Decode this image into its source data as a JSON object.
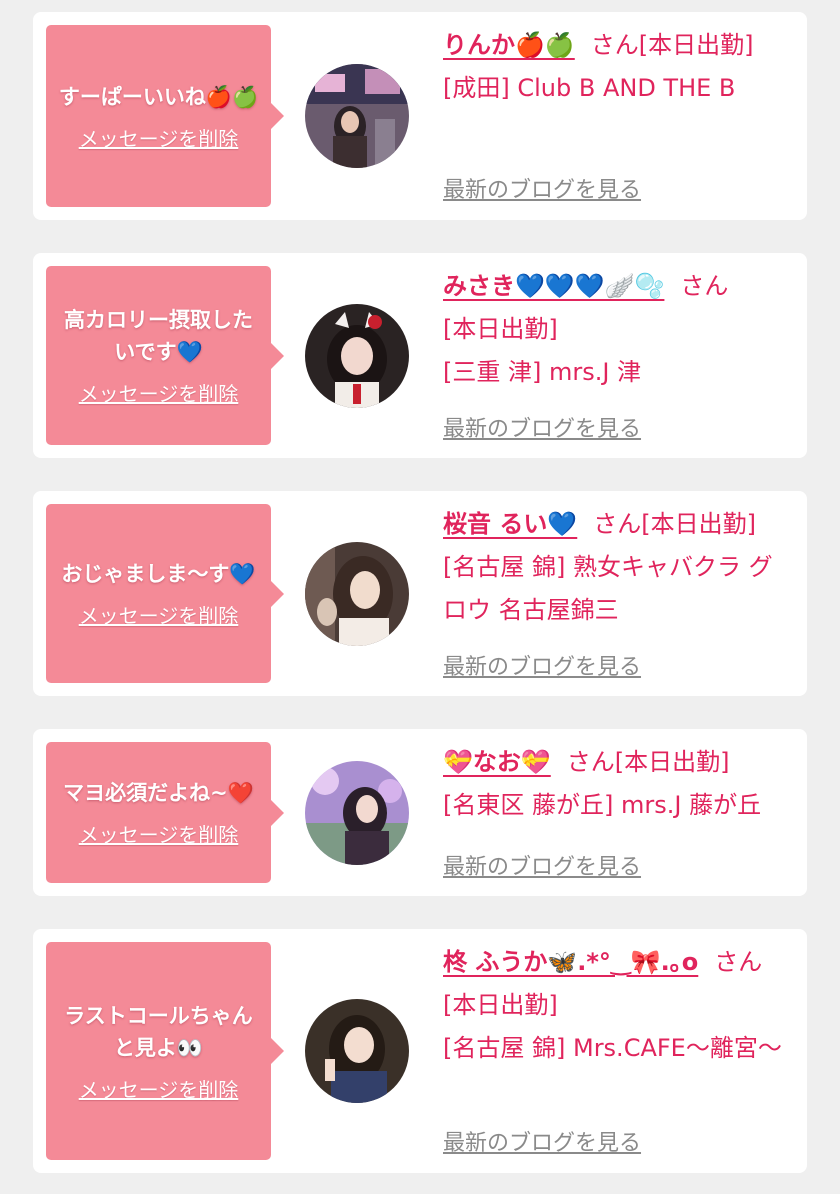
{
  "colors": {
    "page_bg": "#efefef",
    "card_bg": "#ffffff",
    "bubble_bg": "#f48a97",
    "accent": "#e0245c",
    "blog_link": "#8a8a8a"
  },
  "cards": [
    {
      "message": "すーぱーいいね🍎🍏",
      "delete_label": "メッセージを削除",
      "name": "りんか🍎🍏",
      "san": "さん",
      "status": "[本日出勤]",
      "shop": "[成田] Club B AND THE B",
      "blog_label": "最新のブログを見る",
      "avatar_icon": "profile-photo"
    },
    {
      "message": "高カロリー摂取したいです💙",
      "delete_label": "メッセージを削除",
      "name": "みさき💙💙💙🪽🫧",
      "san": "さん",
      "status": "[本日出勤]",
      "shop": "[三重 津] mrs.J 津",
      "blog_label": "最新のブログを見る",
      "avatar_icon": "profile-photo"
    },
    {
      "message": "おじゃましま〜す💙",
      "delete_label": "メッセージを削除",
      "name": "桜音 るい💙",
      "san": "さん",
      "status": "[本日出勤]",
      "shop": "[名古屋 錦] 熟女キャバクラ グロウ 名古屋錦三",
      "blog_label": "最新のブログを見る",
      "avatar_icon": "profile-photo"
    },
    {
      "message": "マヨ必須だよね~❤️",
      "delete_label": "メッセージを削除",
      "name": "💝なお💝",
      "san": "さん",
      "status": "[本日出勤]",
      "shop": "[名東区 藤が丘] mrs.J 藤が丘",
      "blog_label": "最新のブログを見る",
      "avatar_icon": "profile-photo"
    },
    {
      "message": "ラストコールちゃんと見よ👀",
      "delete_label": "メッセージを削除",
      "name": "柊 ふうか🦋.*°‿🎀.｡o",
      "san": "さん",
      "status": "[本日出勤]",
      "shop": "[名古屋 錦] Mrs.CAFE〜離宮〜",
      "blog_label": "最新のブログを見る",
      "avatar_icon": "profile-photo"
    }
  ]
}
